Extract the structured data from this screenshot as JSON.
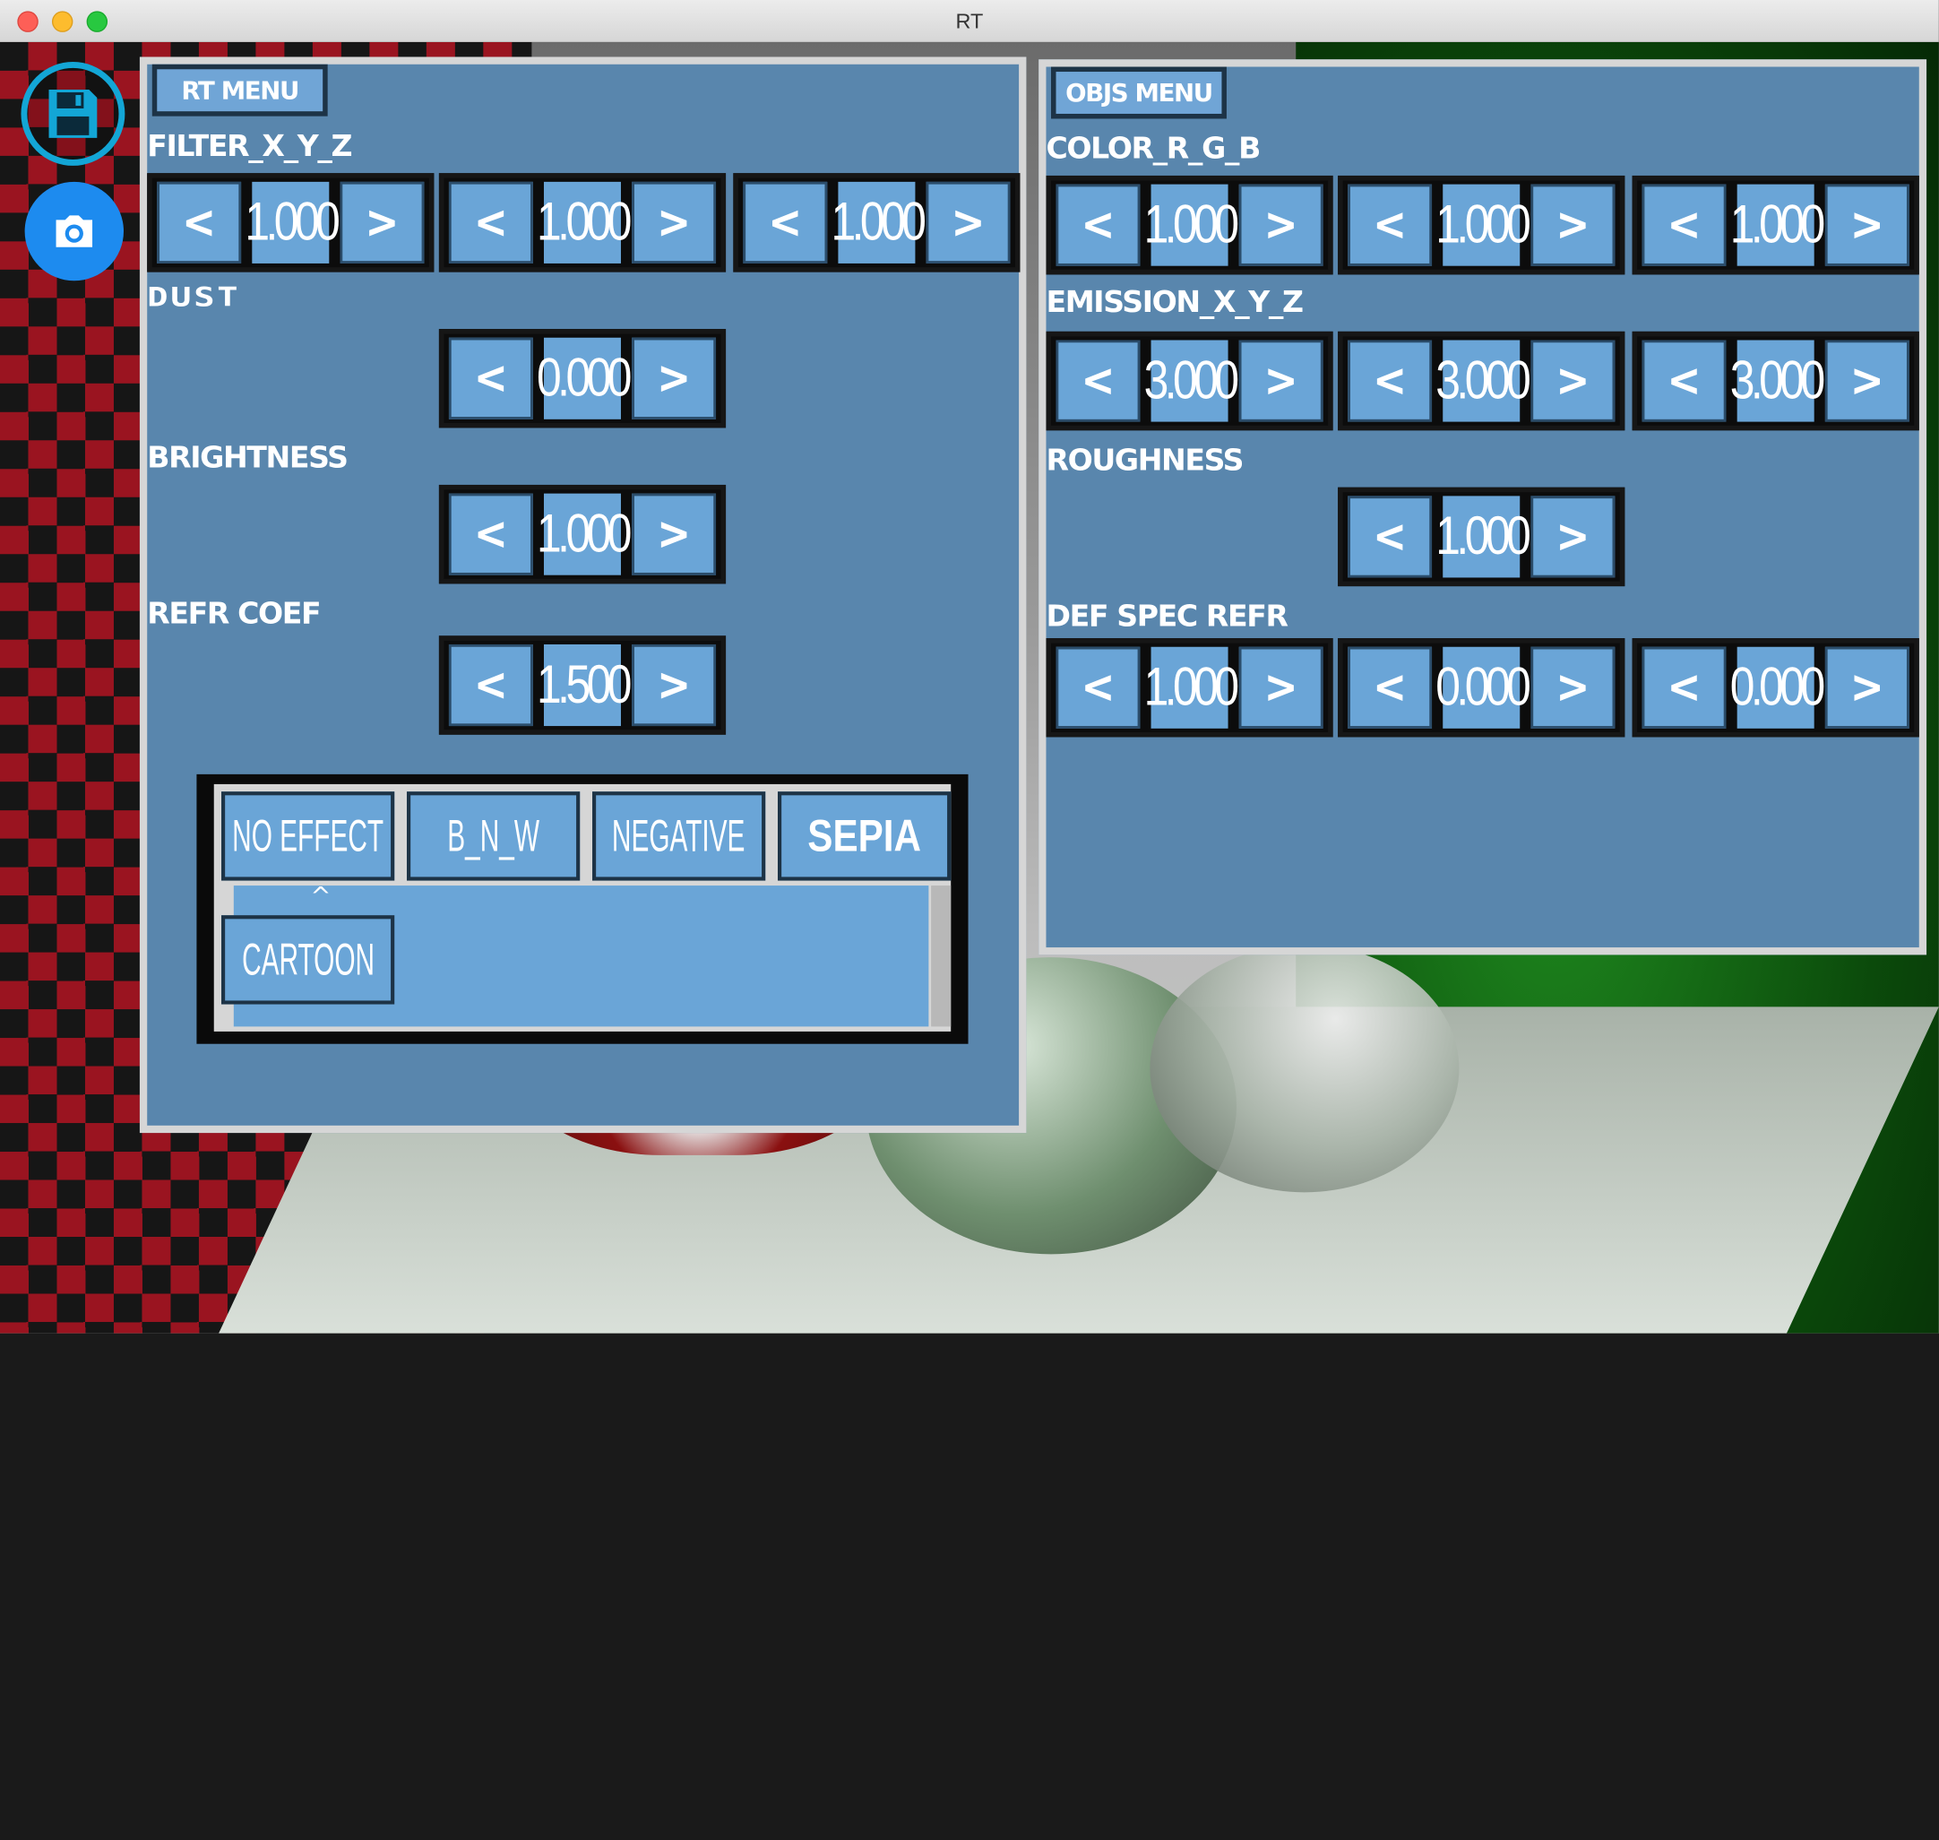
{
  "window": {
    "title": "RT"
  },
  "sidebar": {
    "save_icon": "floppy-disk-icon",
    "screenshot_icon": "camera-icon",
    "accent": "#13a6d6"
  },
  "rt_menu": {
    "tab_label": "RT MENU",
    "filter": {
      "label": "FILTER_X_Y_Z",
      "values": [
        "1.000",
        "1.000",
        "1.000"
      ]
    },
    "dust": {
      "label": "DUST",
      "value": "0.000"
    },
    "brightness": {
      "label": "BRIGHTNESS",
      "value": "1.000"
    },
    "refr_coef": {
      "label": "REFR COEF",
      "value": "1.500"
    },
    "effects": {
      "buttons": [
        "NO EFFECT",
        "B_N_W",
        "NEGATIVE",
        "SEPIA",
        "CARTOON"
      ],
      "caret": "^"
    }
  },
  "objs_menu": {
    "tab_label": "OBJS MENU",
    "color": {
      "label": "COLOR_R_G_B",
      "values": [
        "1.000",
        "1.000",
        "1.000"
      ]
    },
    "emission": {
      "label": "EMISSION_X_Y_Z",
      "values": [
        "3.000",
        "3.000",
        "3.000"
      ]
    },
    "roughness": {
      "label": "ROUGHNESS",
      "value": "1.000"
    },
    "def_spec_refr": {
      "label": "DEF SPEC REFR",
      "values": [
        "1.000",
        "0.000",
        "0.000"
      ]
    }
  },
  "spinner_glyphs": {
    "decrement": "<",
    "increment": ">"
  },
  "colors": {
    "panel": "#5986ad",
    "button": "#6aa5d7",
    "border": "#d6d6d6"
  }
}
